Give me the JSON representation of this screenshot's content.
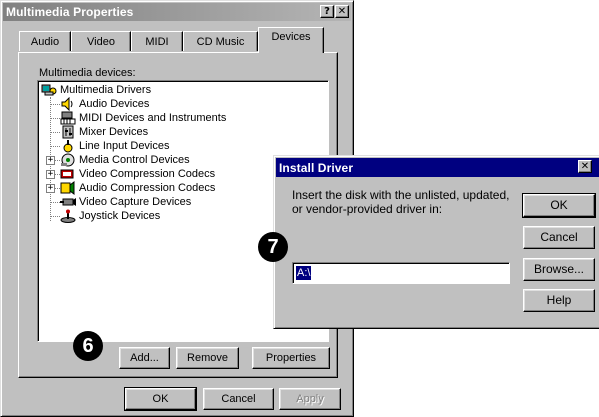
{
  "multimedia": {
    "title": "Multimedia Properties",
    "title_buttons": [
      "?",
      "✕"
    ],
    "tabs": [
      "Audio",
      "Video",
      "MIDI",
      "CD Music",
      "Devices"
    ],
    "list_label": "Multimedia devices:",
    "tree": [
      {
        "label": "Multimedia Drivers",
        "icon": "multimedia-drivers-icon"
      },
      {
        "label": "Audio Devices",
        "icon": "speaker-icon"
      },
      {
        "label": "MIDI Devices and Instruments",
        "icon": "midi-keyboard-icon"
      },
      {
        "label": "Mixer Devices",
        "icon": "mixer-icon"
      },
      {
        "label": "Line Input Devices",
        "icon": "line-input-icon"
      },
      {
        "label": "Media Control Devices",
        "icon": "media-control-icon"
      },
      {
        "label": "Video Compression Codecs",
        "icon": "video-codec-icon"
      },
      {
        "label": "Audio Compression Codecs",
        "icon": "audio-codec-icon"
      },
      {
        "label": "Video Capture Devices",
        "icon": "video-capture-icon"
      },
      {
        "label": "Joystick Devices",
        "icon": "joystick-icon"
      }
    ],
    "buttons": {
      "add": "Add...",
      "remove": "Remove",
      "properties": "Properties"
    },
    "footer": {
      "ok": "OK",
      "cancel": "Cancel",
      "apply": "Apply"
    }
  },
  "install": {
    "title": "Install Driver",
    "close": "✕",
    "message_line1": "Insert the disk with the unlisted, updated,",
    "message_line2": "or vendor-provided driver in:",
    "path_value": "A:\\",
    "buttons": {
      "ok": "OK",
      "cancel": "Cancel",
      "browse": "Browse...",
      "help": "Help"
    }
  },
  "callouts": {
    "step6": "6",
    "step7": "7"
  },
  "colors": {
    "active_title": "#000080",
    "inactive_title": "#808080",
    "face": "#c0c0c0"
  }
}
